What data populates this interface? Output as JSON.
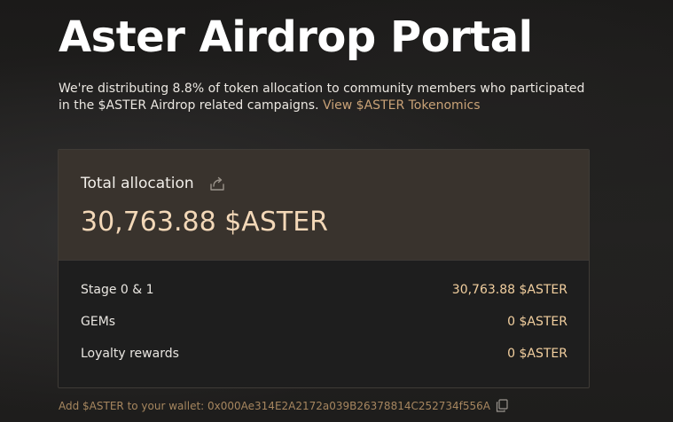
{
  "header": {
    "title": "Aster Airdrop Portal",
    "description": "We're distributing 8.8% of token allocation to community members who participated in the $ASTER Airdrop related campaigns.",
    "tokenomics_link": "View $ASTER Tokenomics"
  },
  "allocation": {
    "label": "Total allocation",
    "value": "30,763.88 $ASTER",
    "share_icon": "share-icon",
    "rows": [
      {
        "label": "Stage 0 & 1",
        "value": "30,763.88 $ASTER"
      },
      {
        "label": "GEMs",
        "value": "0 $ASTER"
      },
      {
        "label": "Loyalty rewards",
        "value": "0 $ASTER"
      }
    ]
  },
  "wallet": {
    "prefix": "Add $ASTER to your wallet: ",
    "address": "0x000Ae314E2A2172a039B26378814C252734f556A",
    "copy_icon": "copy-icon"
  },
  "colors": {
    "accent": "#c9a277",
    "value_highlight": "#f3d8b8",
    "row_value": "#f2cf9f",
    "card_header_bg": "#39332d"
  }
}
